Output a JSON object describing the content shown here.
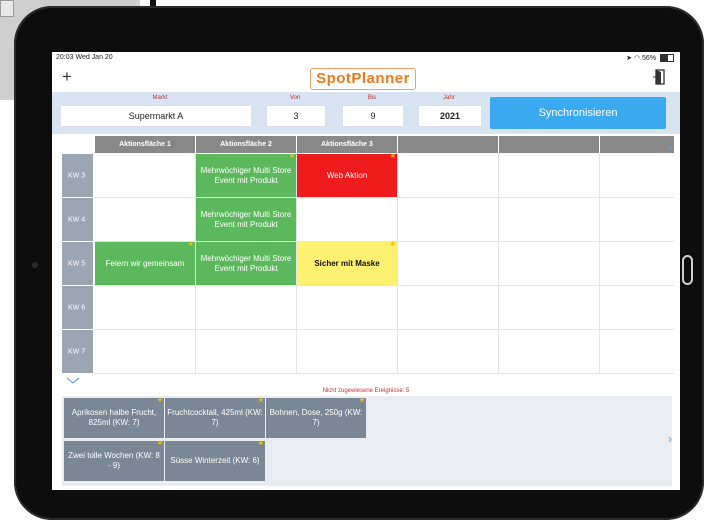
{
  "status_bar": {
    "time": "20:03  Wed Jan 20",
    "battery": "56%",
    "battery_level": 0.56
  },
  "header": {
    "add_label": "+",
    "logo_text": "SpotPlanner"
  },
  "filters": {
    "markt_label": "Markt",
    "markt_value": "Supermarkt  A",
    "von_label": "Von",
    "von_value": "3",
    "bis_label": "Bis",
    "bis_value": "9",
    "jahr_label": "Jahr",
    "jahr_value": "2021",
    "sync_label": "Synchronisieren"
  },
  "grid": {
    "columns": [
      "Aktionsfläche 1",
      "Aktionsfläche 2",
      "Aktionsfläche 3",
      "",
      "",
      ""
    ],
    "rows": [
      {
        "label": "KW 3",
        "cells": [
          null,
          {
            "text": "Mehrwöchiger Multi Store Event mit Produkt",
            "color": "#5cb85c",
            "star": true
          },
          {
            "text": "Web Aktion",
            "color": "#ee1c1c",
            "star": true
          },
          null,
          null,
          null
        ]
      },
      {
        "label": "KW 4",
        "cells": [
          null,
          {
            "text": "Mehrwöchiger Multi Store Event mit Produkt",
            "color": "#5cb85c",
            "star": false
          },
          null,
          null,
          null,
          null
        ]
      },
      {
        "label": "KW 5",
        "cells": [
          {
            "text": "Feiern wir gemeinsam",
            "color": "#5cb85c",
            "star": true
          },
          {
            "text": "Mehrwöchiger Multi Store Event mit Produkt",
            "color": "#5cb85c",
            "star": false
          },
          {
            "text": "Sicher mit Maske",
            "color": "#fff170",
            "star": true,
            "dark": true
          },
          null,
          null,
          null
        ]
      },
      {
        "label": "KW 6",
        "cells": [
          null,
          null,
          null,
          null,
          null,
          null
        ]
      },
      {
        "label": "KW 7",
        "cells": [
          null,
          null,
          null,
          null,
          null,
          null
        ]
      }
    ]
  },
  "unassigned": {
    "title": "Nicht zugewiesene Ereignisse: 5",
    "items": [
      {
        "text": "Aprikosen halbe Frucht, 825ml (KW: 7)",
        "star": true
      },
      {
        "text": "Fruchtcocktail, 425ml (KW: 7)",
        "star": true
      },
      {
        "text": "Bohnen, Dose, 250g (KW: 7)",
        "star": true
      },
      {
        "text": "Zwei tolle Wochen (KW: 8 - 9)",
        "star": true
      },
      {
        "text": "Süsse Winterzeit (KW: 6)",
        "star": true
      }
    ]
  },
  "icons": {
    "add": "plus-icon",
    "exit": "door-exit-icon",
    "expand": "chevron-down-icon",
    "scroll": "chevron-right-icon",
    "wifi": "wifi-icon",
    "battery": "battery-icon"
  }
}
